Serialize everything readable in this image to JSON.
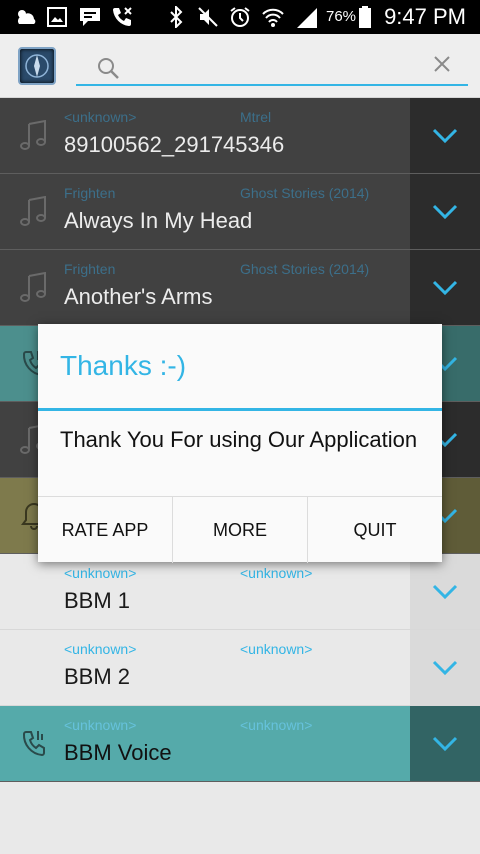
{
  "status_bar": {
    "time": "9:47 PM",
    "battery": "76%",
    "icons": [
      "weather-icon",
      "gallery-icon",
      "message-icon",
      "missed-call-icon",
      "bluetooth-icon",
      "mute-icon",
      "alarm-icon",
      "wifi-icon",
      "signal-icon",
      "battery-icon"
    ]
  },
  "search": {
    "placeholder": "",
    "value": ""
  },
  "list": [
    {
      "artist": "<unknown>",
      "album": "Mtrel",
      "title": "89100562_291745346",
      "icon": "music-note-icon",
      "style": "dark"
    },
    {
      "artist": "Frighten",
      "album": "Ghost Stories (2014)",
      "title": "Always In My Head",
      "icon": "music-note-icon",
      "style": "dark"
    },
    {
      "artist": "Frighten",
      "album": "Ghost Stories (2014)",
      "title": "Another's Arms",
      "icon": "music-note-icon",
      "style": "dark"
    },
    {
      "artist": "",
      "album": "",
      "title": "",
      "icon": "phone-ringtone-icon",
      "style": "teal"
    },
    {
      "artist": "",
      "album": "",
      "title": "",
      "icon": "music-note-icon",
      "style": "dark"
    },
    {
      "artist": "",
      "album": "",
      "title": "",
      "icon": "bell-icon",
      "style": "olive"
    },
    {
      "artist": "<unknown>",
      "album": "<unknown>",
      "title": "BBM 1",
      "icon": "",
      "style": "light"
    },
    {
      "artist": "<unknown>",
      "album": "<unknown>",
      "title": "BBM 2",
      "icon": "",
      "style": "light"
    },
    {
      "artist": "<unknown>",
      "album": "<unknown>",
      "title": "BBM Voice",
      "icon": "phone-ringtone-icon",
      "style": "voice"
    }
  ],
  "dialog": {
    "title": "Thanks :-)",
    "message": "Thank You For using Our Application",
    "buttons": [
      "RATE APP",
      "MORE",
      "QUIT"
    ]
  },
  "colors": {
    "accent": "#33b5e5"
  }
}
